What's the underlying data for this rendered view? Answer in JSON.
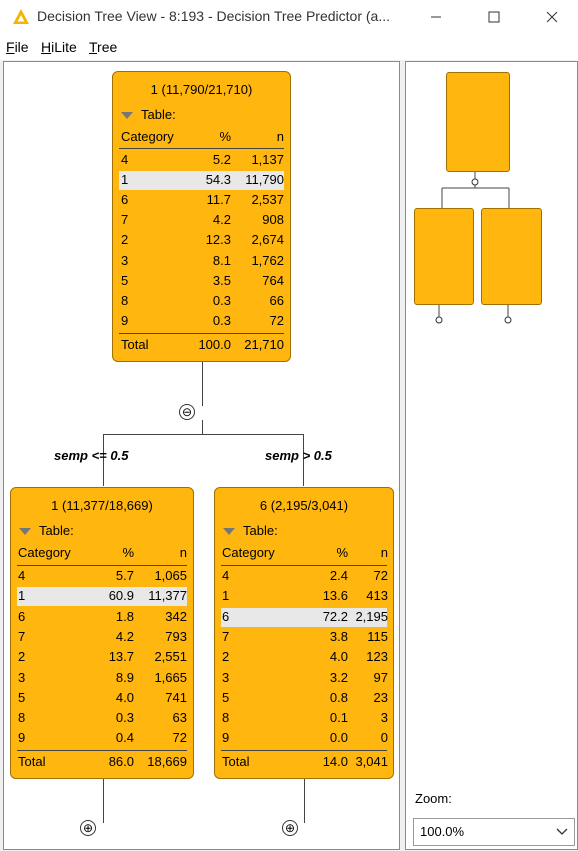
{
  "window": {
    "title": "Decision Tree View - 8:193 - Decision Tree Predictor (a...",
    "minimize": "—",
    "maximize": "☐",
    "close": "✕"
  },
  "menu": [
    {
      "underline": "F",
      "rest": "ile"
    },
    {
      "underline": "H",
      "rest": "iLite"
    },
    {
      "underline": "T",
      "rest": "ree"
    }
  ],
  "tree": {
    "root": {
      "header": "1 (11,790/21,710)",
      "table_label": "Table:",
      "columns": [
        "Category",
        "%",
        "n"
      ],
      "rows": [
        {
          "cat": "4",
          "pct": "5.2",
          "n": "1,137"
        },
        {
          "cat": "1",
          "pct": "54.3",
          "n": "11,790",
          "selected": true
        },
        {
          "cat": "6",
          "pct": "11.7",
          "n": "2,537"
        },
        {
          "cat": "7",
          "pct": "4.2",
          "n": "908"
        },
        {
          "cat": "2",
          "pct": "12.3",
          "n": "2,674"
        },
        {
          "cat": "3",
          "pct": "8.1",
          "n": "1,762"
        },
        {
          "cat": "5",
          "pct": "3.5",
          "n": "764"
        },
        {
          "cat": "8",
          "pct": "0.3",
          "n": "66"
        },
        {
          "cat": "9",
          "pct": "0.3",
          "n": "72"
        }
      ],
      "total": {
        "label": "Total",
        "pct": "100.0",
        "n": "21,710"
      }
    },
    "collapse_symbol": "⊖",
    "left_split": "semp <= 0.5",
    "right_split": "semp > 0.5",
    "left": {
      "header": "1 (11,377/18,669)",
      "table_label": "Table:",
      "columns": [
        "Category",
        "%",
        "n"
      ],
      "rows": [
        {
          "cat": "4",
          "pct": "5.7",
          "n": "1,065"
        },
        {
          "cat": "1",
          "pct": "60.9",
          "n": "11,377",
          "selected": true
        },
        {
          "cat": "6",
          "pct": "1.8",
          "n": "342"
        },
        {
          "cat": "7",
          "pct": "4.2",
          "n": "793"
        },
        {
          "cat": "2",
          "pct": "13.7",
          "n": "2,551"
        },
        {
          "cat": "3",
          "pct": "8.9",
          "n": "1,665"
        },
        {
          "cat": "5",
          "pct": "4.0",
          "n": "741"
        },
        {
          "cat": "8",
          "pct": "0.3",
          "n": "63"
        },
        {
          "cat": "9",
          "pct": "0.4",
          "n": "72"
        }
      ],
      "total": {
        "label": "Total",
        "pct": "86.0",
        "n": "18,669"
      }
    },
    "right": {
      "header": "6 (2,195/3,041)",
      "table_label": "Table:",
      "columns": [
        "Category",
        "%",
        "n"
      ],
      "rows": [
        {
          "cat": "4",
          "pct": "2.4",
          "n": "72"
        },
        {
          "cat": "1",
          "pct": "13.6",
          "n": "413"
        },
        {
          "cat": "6",
          "pct": "72.2",
          "n": "2,195",
          "selected": true
        },
        {
          "cat": "7",
          "pct": "3.8",
          "n": "115"
        },
        {
          "cat": "2",
          "pct": "4.0",
          "n": "123"
        },
        {
          "cat": "3",
          "pct": "3.2",
          "n": "97"
        },
        {
          "cat": "5",
          "pct": "0.8",
          "n": "23"
        },
        {
          "cat": "8",
          "pct": "0.1",
          "n": "3"
        },
        {
          "cat": "9",
          "pct": "0.0",
          "n": "0"
        }
      ],
      "total": {
        "label": "Total",
        "pct": "14.0",
        "n": "3,041"
      }
    },
    "expand_symbol": "⊕"
  },
  "zoom": {
    "label": "Zoom:",
    "value": "100.0%"
  },
  "colors": {
    "node_fill": "#ffb60e",
    "node_border": "#a07000",
    "selected_row": "#e8e8e8"
  }
}
